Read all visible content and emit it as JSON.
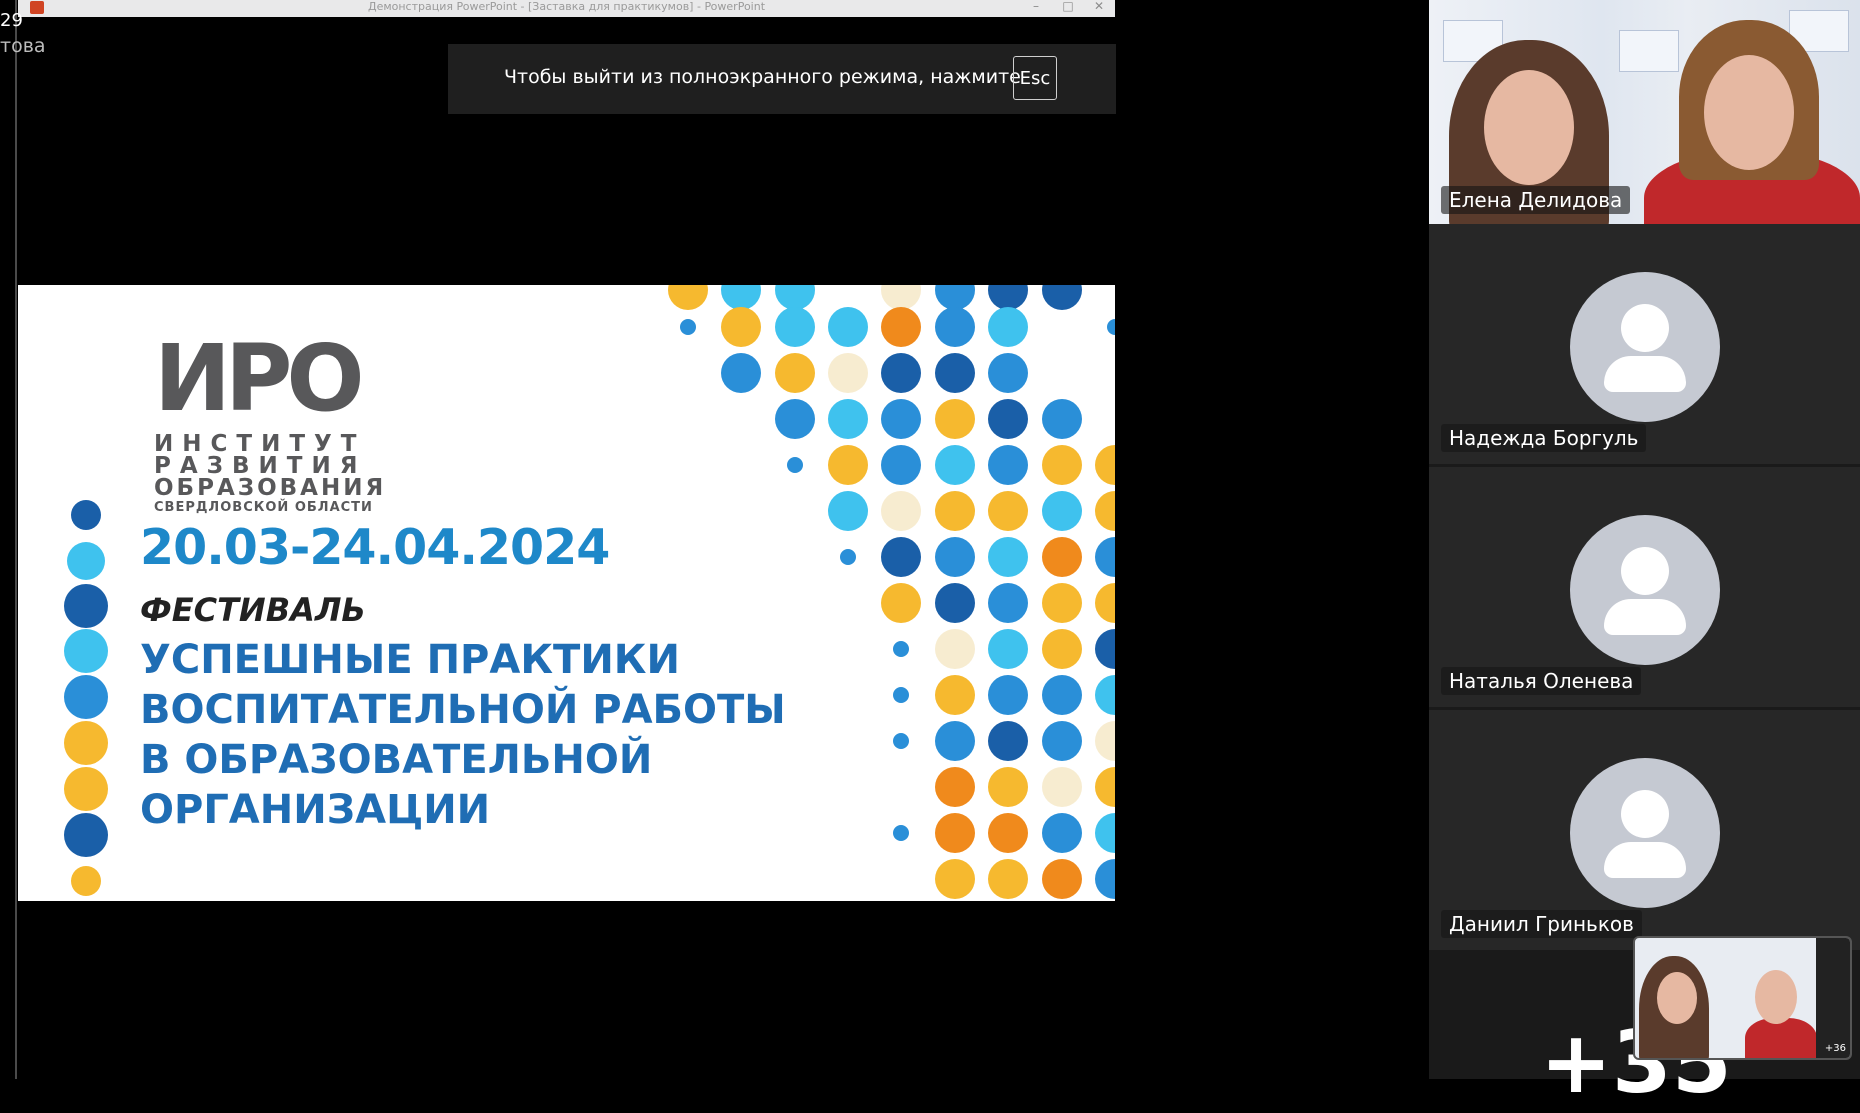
{
  "window": {
    "title": "Демонстрация PowerPoint - [Заставка для практикумов] - PowerPoint",
    "controls": [
      "–",
      "□",
      "✕"
    ]
  },
  "left_panel": {
    "time": "29",
    "name": "това"
  },
  "fullscreen_notice": {
    "text": "Чтобы выйти из полноэкранного режима, нажмите",
    "key": "Esc"
  },
  "slide": {
    "logo_word": "ИРО",
    "logo_lines": [
      "ИНСТИТУТ",
      "РАЗВИТИЯ",
      "ОБРАЗОВАНИЯ"
    ],
    "logo_region": "СВЕРДЛОВСКОЙ ОБЛАСТИ",
    "dates": "20.03-24.04.2024",
    "festival": "ФЕСТИВАЛЬ",
    "headline": [
      "УСПЕШНЫЕ ПРАКТИКИ",
      "ВОСПИТАТЕЛЬНОЙ РАБОТЫ",
      "В ОБРАЗОВАТЕЛЬНОЙ",
      "ОРГАНИЗАЦИИ"
    ],
    "colors": {
      "dark_blue": "#1a5fa8",
      "blue": "#2a8fd8",
      "light_blue": "#3fc2ee",
      "orange": "#f08a1c",
      "yellow": "#f6b92f",
      "cream": "#f7ecd0",
      "gray_text": "#58585a"
    }
  },
  "participants": [
    {
      "name": "Елена Делидова",
      "video": true
    },
    {
      "name": "Надежда Боргуль",
      "video": false
    },
    {
      "name": "Наталья Оленева",
      "video": false
    },
    {
      "name": "Даниил Гриньков",
      "video": false
    }
  ],
  "self_view": {
    "count": "+36"
  },
  "more_count": "+35"
}
